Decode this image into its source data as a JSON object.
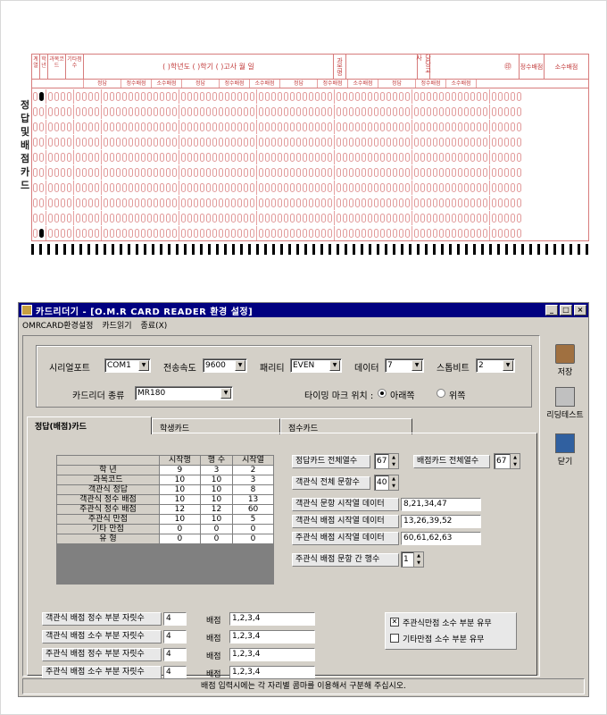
{
  "omr_card": {
    "side_title": "정답 및 배점카드",
    "title_line": "(    )학년도 (    )학기 (            )고사      월      일",
    "header_cells": [
      "계열",
      "학년",
      "과목코드",
      "기타점수"
    ],
    "subject_label": "과목명",
    "exam_label": "담당교사",
    "sub_labels": [
      "정답",
      "정수배점",
      "소수배점"
    ],
    "score_labels": [
      "정수배점",
      "소수배점"
    ]
  },
  "window": {
    "title": "카드리더기 - [O.M.R CARD READER 환경 설정]",
    "buttons": {
      "minimize": "_",
      "maximize": "□",
      "close": "×"
    },
    "menu": [
      "OMRCARD환경설정",
      "카드읽기",
      "종료(X)"
    ]
  },
  "settings": {
    "serial_port_label": "시리얼포트",
    "serial_port_value": "COM1",
    "baud_label": "전송속도",
    "baud_value": "9600",
    "parity_label": "패리티",
    "parity_value": "EVEN",
    "data_label": "데이터",
    "data_value": "7",
    "stopbit_label": "스톱비트",
    "stopbit_value": "2",
    "reader_type_label": "카드리더 종류",
    "reader_type_value": "MR180",
    "timing_label": "타이밍 마크 위치 :",
    "timing_opt_bottom": "아래쪽",
    "timing_opt_top": "위쪽"
  },
  "tabs": [
    "정답(배점)카드",
    "학생카드",
    "점수카드"
  ],
  "table": {
    "headers": [
      "",
      "시작행",
      "행  수",
      "시작열"
    ],
    "rows": [
      [
        "학    년",
        "9",
        "3",
        "2"
      ],
      [
        "과목코드",
        "10",
        "10",
        "3"
      ],
      [
        "객관식 정답",
        "10",
        "10",
        "8"
      ],
      [
        "객관식 정수 배점",
        "10",
        "10",
        "13"
      ],
      [
        "주관식 정수 배점",
        "12",
        "12",
        "60"
      ],
      [
        "주관식 만점",
        "10",
        "10",
        "5"
      ],
      [
        "기타 만점",
        "0",
        "0",
        "0"
      ],
      [
        "유    형",
        "0",
        "0",
        "0"
      ]
    ]
  },
  "right_fields": {
    "answer_cols_label": "정답카드 전체열수",
    "answer_cols_value": "67",
    "score_cols_label": "배점카드 전체열수",
    "score_cols_value": "67",
    "obj_count_label": "객관식 전체 문항수",
    "obj_count_value": "40",
    "obj_start_label": "객관식 문항 시작열 데이터",
    "obj_start_value": "8,21,34,47",
    "obj_score_label": "객관식 배점 시작열 데이터",
    "obj_score_value": "13,26,39,52",
    "sub_score_label": "주관식 배점 시작열 데이터",
    "sub_score_value": "60,61,62,63",
    "sub_rows_label": "주관식 배점 문항 간 행수",
    "sub_rows_value": "1"
  },
  "bottom_fields": [
    {
      "label": "객관식 배점 정수 부분 자릿수",
      "value": "4",
      "score_label": "배점",
      "score_value": "1,2,3,4"
    },
    {
      "label": "객관식 배점 소수 부분 자릿수",
      "value": "4",
      "score_label": "배점",
      "score_value": "1,2,3,4"
    },
    {
      "label": "주관식 배점 정수 부분 자릿수",
      "value": "4",
      "score_label": "배점",
      "score_value": "1,2,3,4"
    },
    {
      "label": "주관식 배점 소수 부분 자릿수",
      "value": "4",
      "score_label": "배점",
      "score_value": "1,2,3,4"
    }
  ],
  "checkboxes": [
    {
      "label": "주관식만점 소수 부분 유무",
      "checked": true,
      "mark": "✕"
    },
    {
      "label": "기타만점 소수 부분 유무",
      "checked": false,
      "mark": ""
    }
  ],
  "status_text": "배점 입력시에는 각 자리별 콤마를 이용해서 구분해 주십시오.",
  "side_buttons": [
    {
      "label": "저장",
      "icon": "save-icon"
    },
    {
      "label": "리딩테스트",
      "icon": "reading-test-icon"
    },
    {
      "label": "닫기",
      "icon": "close-door-icon"
    }
  ],
  "colors": {
    "title_bar": "#000080",
    "omr_red": "#c23a3a",
    "window_face": "#d4d0c8"
  }
}
